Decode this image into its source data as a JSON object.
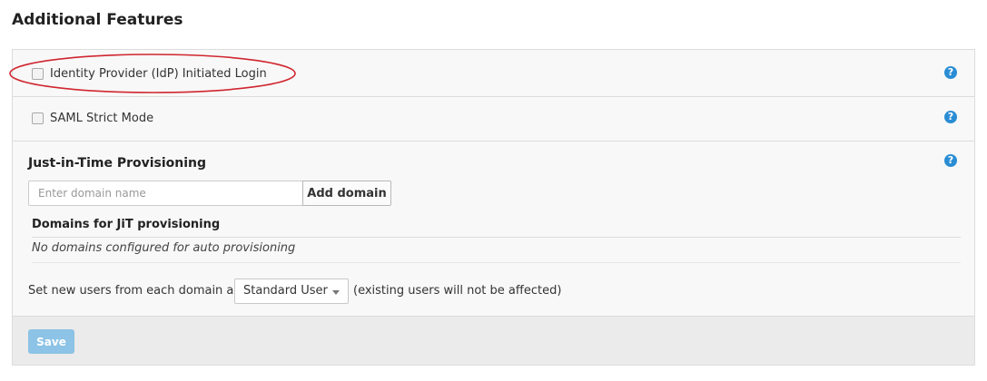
{
  "section_title": "Additional Features",
  "features": {
    "idp_login": {
      "label": "Identity Provider (IdP) Initiated Login",
      "checked": false
    },
    "saml_strict": {
      "label": "SAML Strict Mode",
      "checked": false
    }
  },
  "help_icon": {
    "name": "question-circle-icon",
    "glyph": "?"
  },
  "jit": {
    "title": "Just-in-Time Provisioning",
    "domain_input_placeholder": "Enter domain name",
    "domain_input_value": "",
    "add_button_label": "Add domain",
    "domains_header": "Domains for JiT provisioning",
    "domains_empty_text": "No domains configured for auto provisioning",
    "set_users_prefix": "Set new users from each domain as",
    "role_selected": "Standard User",
    "set_users_suffix": "(existing users will not be affected)"
  },
  "save_label": "Save",
  "colors": {
    "accent": "#2a8dd4",
    "save_disabled": "#8cc3e6",
    "highlight_ellipse": "#d0262f"
  }
}
